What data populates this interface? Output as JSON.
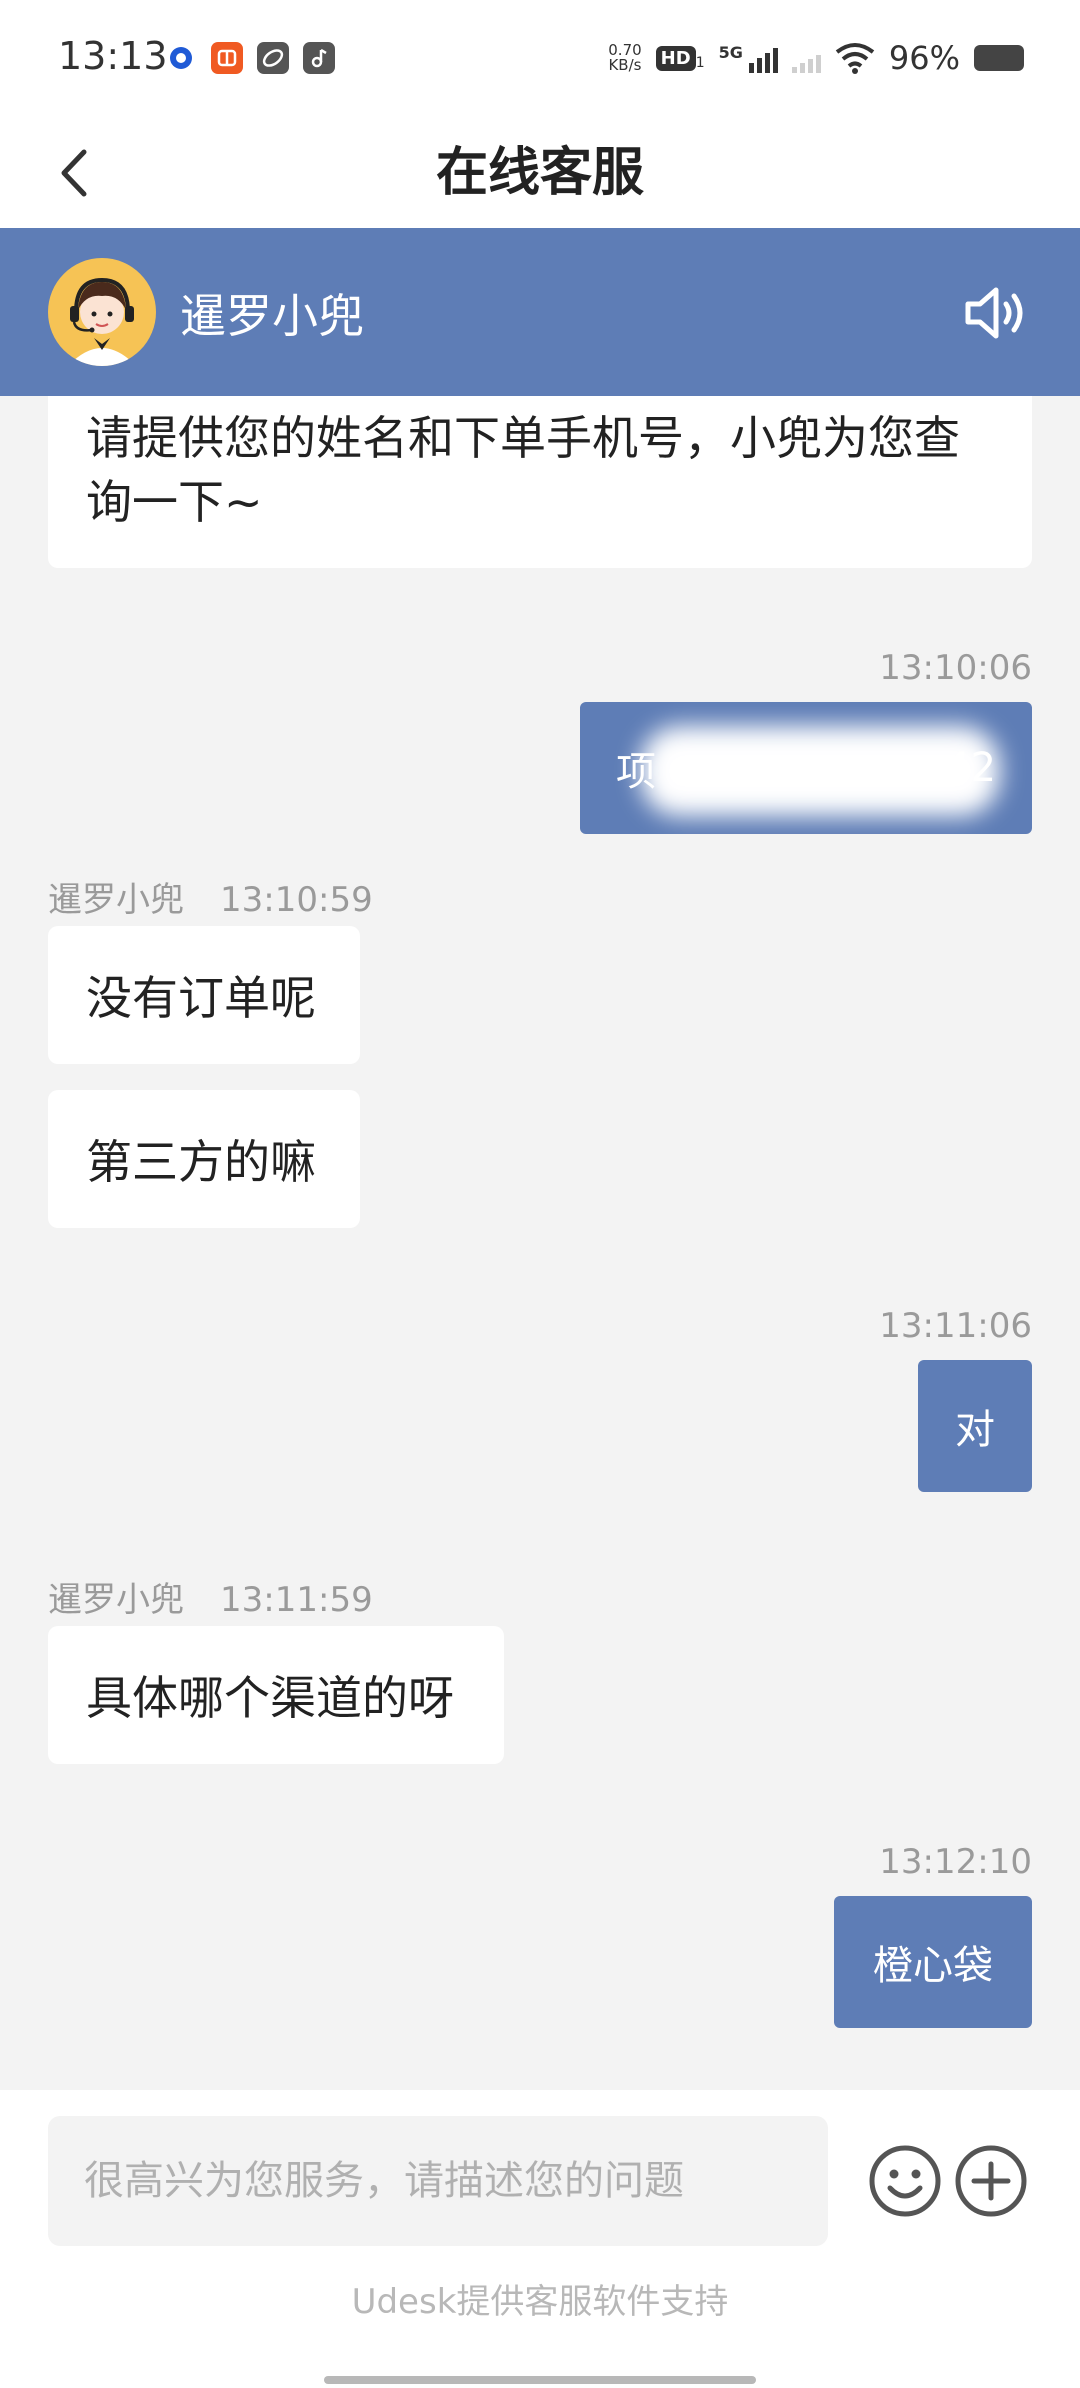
{
  "status_bar": {
    "time": "13:13",
    "net_speed_value": "0.70",
    "net_speed_unit": "KB/s",
    "hd_label": "HD",
    "hd_sub": "1",
    "gen_label": "5G",
    "battery_text": "96%",
    "app_icons": [
      "blue-circle-app-icon",
      "orange-app-icon",
      "leaf-app-icon",
      "music-app-icon"
    ]
  },
  "title_bar": {
    "title": "在线客服"
  },
  "agent": {
    "name": "暹罗小兜"
  },
  "messages": [
    {
      "side": "left",
      "text": "请提供您的姓名和下单手机号，小兜为您查询一下~"
    },
    {
      "side": "right",
      "time": "13:10:06",
      "text": "项",
      "text_tail": "42",
      "redacted": true
    },
    {
      "side": "left",
      "sender": "暹罗小兜",
      "time": "13:10:59",
      "text": "没有订单呢"
    },
    {
      "side": "left",
      "text": "第三方的嘛"
    },
    {
      "side": "right",
      "time": "13:11:06",
      "text": "对"
    },
    {
      "side": "left",
      "sender": "暹罗小兜",
      "time": "13:11:59",
      "text": "具体哪个渠道的呀"
    },
    {
      "side": "right",
      "time": "13:12:10",
      "text": "橙心袋"
    }
  ],
  "input": {
    "placeholder": "很高兴为您服务，请描述您的问题"
  },
  "footer": {
    "powered_by": "Udesk提供客服软件支持"
  },
  "colors": {
    "accent": "#5e7db6",
    "background": "#f3f3f3",
    "avatar_bg": "#f6c355"
  }
}
